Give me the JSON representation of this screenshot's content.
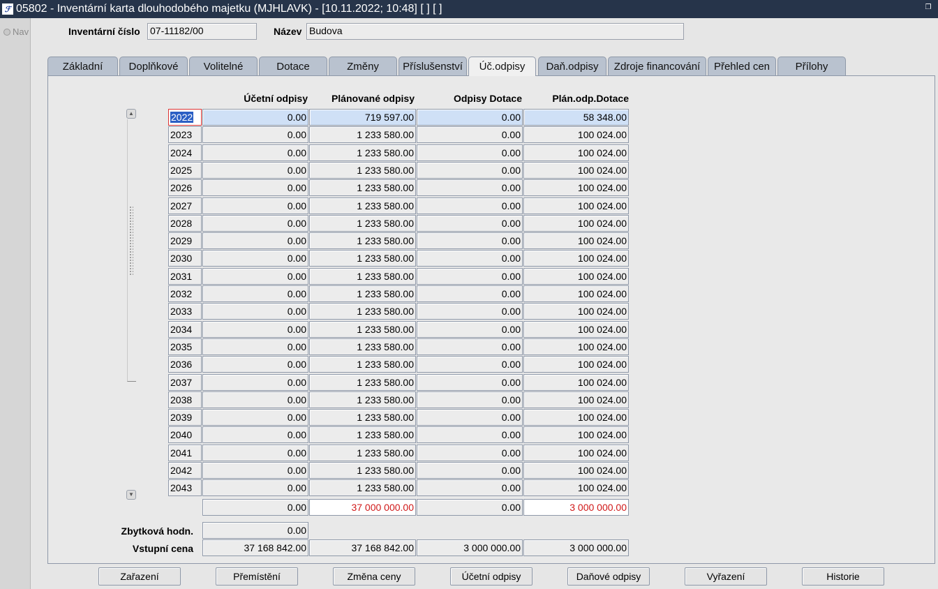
{
  "window": {
    "title": "05802 - Inventární karta dlouhodobého majetku (MJHLAVK) - [10.11.2022; 10:48]  [ ]  [ ]"
  },
  "nav": {
    "label": "Nav"
  },
  "header": {
    "inv_label": "Inventární číslo",
    "inv_value": "07-11182/00",
    "name_label": "Název",
    "name_value": "Budova"
  },
  "tabs": [
    "Základní",
    "Doplňkové",
    "Volitelné",
    "Dotace",
    "Změny",
    "Příslušenství",
    "Úč.odpisy",
    "Daň.odpisy",
    "Zdroje financování",
    "Přehled cen",
    "Přílohy"
  ],
  "active_tab": "Úč.odpisy",
  "table": {
    "columns": [
      "Účetní odpisy",
      "Plánované odpisy",
      "Odpisy Dotace",
      "Plán.odp.Dotace"
    ],
    "rows": [
      {
        "year": "2022",
        "ucetni": "0.00",
        "planovane": "719 597.00",
        "dotace": "0.00",
        "plan_dotace": "58 348.00"
      },
      {
        "year": "2023",
        "ucetni": "0.00",
        "planovane": "1 233 580.00",
        "dotace": "0.00",
        "plan_dotace": "100 024.00"
      },
      {
        "year": "2024",
        "ucetni": "0.00",
        "planovane": "1 233 580.00",
        "dotace": "0.00",
        "plan_dotace": "100 024.00"
      },
      {
        "year": "2025",
        "ucetni": "0.00",
        "planovane": "1 233 580.00",
        "dotace": "0.00",
        "plan_dotace": "100 024.00"
      },
      {
        "year": "2026",
        "ucetni": "0.00",
        "planovane": "1 233 580.00",
        "dotace": "0.00",
        "plan_dotace": "100 024.00"
      },
      {
        "year": "2027",
        "ucetni": "0.00",
        "planovane": "1 233 580.00",
        "dotace": "0.00",
        "plan_dotace": "100 024.00"
      },
      {
        "year": "2028",
        "ucetni": "0.00",
        "planovane": "1 233 580.00",
        "dotace": "0.00",
        "plan_dotace": "100 024.00"
      },
      {
        "year": "2029",
        "ucetni": "0.00",
        "planovane": "1 233 580.00",
        "dotace": "0.00",
        "plan_dotace": "100 024.00"
      },
      {
        "year": "2030",
        "ucetni": "0.00",
        "planovane": "1 233 580.00",
        "dotace": "0.00",
        "plan_dotace": "100 024.00"
      },
      {
        "year": "2031",
        "ucetni": "0.00",
        "planovane": "1 233 580.00",
        "dotace": "0.00",
        "plan_dotace": "100 024.00"
      },
      {
        "year": "2032",
        "ucetni": "0.00",
        "planovane": "1 233 580.00",
        "dotace": "0.00",
        "plan_dotace": "100 024.00"
      },
      {
        "year": "2033",
        "ucetni": "0.00",
        "planovane": "1 233 580.00",
        "dotace": "0.00",
        "plan_dotace": "100 024.00"
      },
      {
        "year": "2034",
        "ucetni": "0.00",
        "planovane": "1 233 580.00",
        "dotace": "0.00",
        "plan_dotace": "100 024.00"
      },
      {
        "year": "2035",
        "ucetni": "0.00",
        "planovane": "1 233 580.00",
        "dotace": "0.00",
        "plan_dotace": "100 024.00"
      },
      {
        "year": "2036",
        "ucetni": "0.00",
        "planovane": "1 233 580.00",
        "dotace": "0.00",
        "plan_dotace": "100 024.00"
      },
      {
        "year": "2037",
        "ucetni": "0.00",
        "planovane": "1 233 580.00",
        "dotace": "0.00",
        "plan_dotace": "100 024.00"
      },
      {
        "year": "2038",
        "ucetni": "0.00",
        "planovane": "1 233 580.00",
        "dotace": "0.00",
        "plan_dotace": "100 024.00"
      },
      {
        "year": "2039",
        "ucetni": "0.00",
        "planovane": "1 233 580.00",
        "dotace": "0.00",
        "plan_dotace": "100 024.00"
      },
      {
        "year": "2040",
        "ucetni": "0.00",
        "planovane": "1 233 580.00",
        "dotace": "0.00",
        "plan_dotace": "100 024.00"
      },
      {
        "year": "2041",
        "ucetni": "0.00",
        "planovane": "1 233 580.00",
        "dotace": "0.00",
        "plan_dotace": "100 024.00"
      },
      {
        "year": "2042",
        "ucetni": "0.00",
        "planovane": "1 233 580.00",
        "dotace": "0.00",
        "plan_dotace": "100 024.00"
      },
      {
        "year": "2043",
        "ucetni": "0.00",
        "planovane": "1 233 580.00",
        "dotace": "0.00",
        "plan_dotace": "100 024.00"
      }
    ],
    "totals": {
      "ucetni": "0.00",
      "planovane": "37 000 000.00",
      "dotace": "0.00",
      "plan_dotace": "3 000 000.00"
    }
  },
  "summary": {
    "zbytkova_label": "Zbytková hodn.",
    "zbytkova_value": "0.00",
    "vstupni_label": "Vstupní cena",
    "vstupni_values": [
      "37 168 842.00",
      "37 168 842.00",
      "3 000 000.00",
      "3 000 000.00"
    ]
  },
  "buttons": [
    "Zařazení",
    "Přemístění",
    "Změna ceny",
    "Účetní odpisy",
    "Daňové odpisy",
    "Vyřazení",
    "Historie"
  ],
  "colors": {
    "titlebar": "#26344a",
    "selected_row": "#cfe0f6",
    "total_text": "#d01818",
    "tab": "#b9c2cf"
  }
}
